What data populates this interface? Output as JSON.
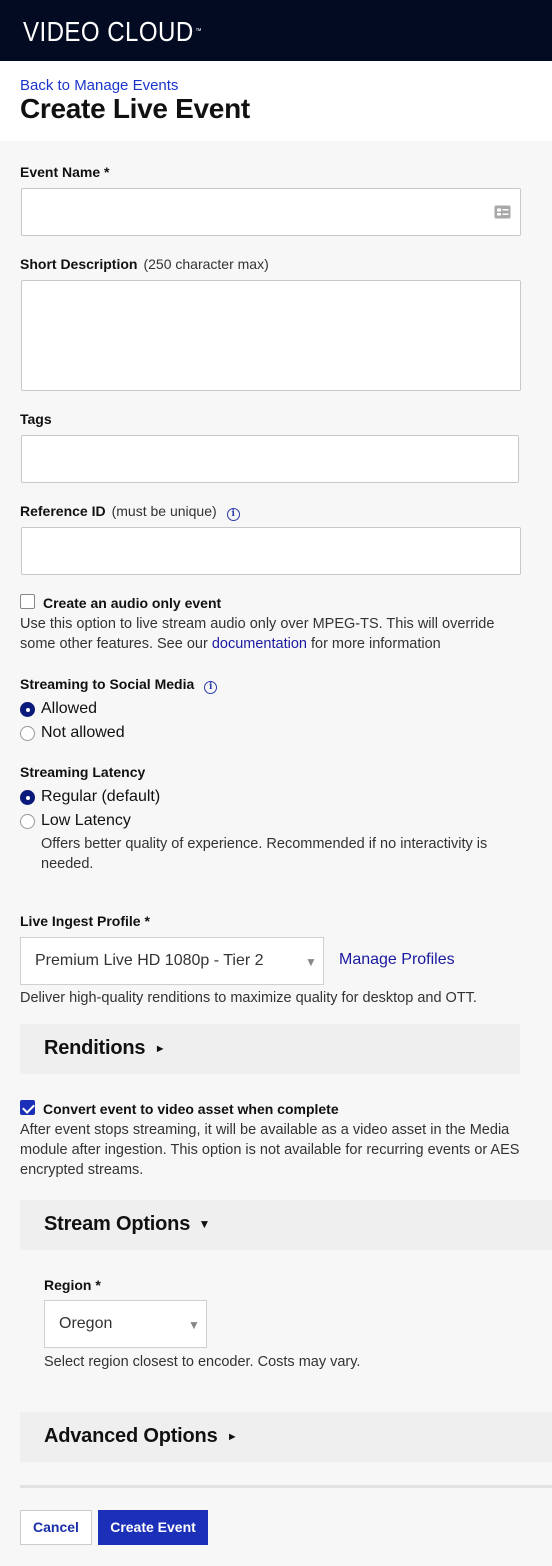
{
  "app": {
    "logo": "VIDEO CLOUD",
    "logo_tm": "™"
  },
  "header": {
    "back_link": "Back to Manage Events",
    "title": "Create Live Event"
  },
  "event_name": {
    "label": "Event Name *",
    "value": ""
  },
  "short_description": {
    "label": "Short Description",
    "hint": "(250 character max)",
    "value": ""
  },
  "tags": {
    "label": "Tags",
    "value": ""
  },
  "reference_id": {
    "label": "Reference ID",
    "hint": "(must be unique)",
    "info_icon": "i"
  },
  "audio_only": {
    "label": "Create an audio only event",
    "checked": false,
    "help_before": "Use this option to live stream audio only over MPEG-TS. This will override some other features. See our ",
    "help_link": "documentation",
    "help_after": " for more information"
  },
  "social_media": {
    "label": "Streaming to Social Media",
    "info_icon": "i",
    "options": [
      "Allowed",
      "Not allowed"
    ],
    "selected": "Allowed"
  },
  "latency": {
    "label": "Streaming Latency",
    "options": [
      "Regular (default)",
      "Low Latency"
    ],
    "selected": "Regular (default)",
    "low_latency_help": "Offers better quality of experience. Recommended if no interactivity is needed."
  },
  "ingest_profile": {
    "label": "Live Ingest Profile *",
    "value": "Premium Live HD 1080p - Tier 2",
    "caret": "▼",
    "manage_link": "Manage Profiles",
    "help": "Deliver high-quality renditions to maximize quality for desktop and OTT."
  },
  "renditions": {
    "title": "Renditions",
    "arrow": "►",
    "expanded": false
  },
  "convert": {
    "label": "Convert event to video asset when complete",
    "checked": true,
    "help": "After event stops streaming, it will be available as a video asset in the Media module after ingestion. This option is not available for recurring events or AES encrypted streams."
  },
  "stream_options": {
    "title": "Stream Options",
    "arrow": "▼",
    "expanded": true,
    "region_label": "Region *",
    "region_value": "Oregon",
    "caret": "▼",
    "region_help": "Select region closest to encoder. Costs may vary."
  },
  "advanced_options": {
    "title": "Advanced Options",
    "arrow": "►",
    "expanded": false
  },
  "actions": {
    "cancel": "Cancel",
    "create": "Create Event"
  },
  "colors": {
    "topbar": "#020b21",
    "primary": "#1c2fb8",
    "link": "#1a35c8"
  }
}
